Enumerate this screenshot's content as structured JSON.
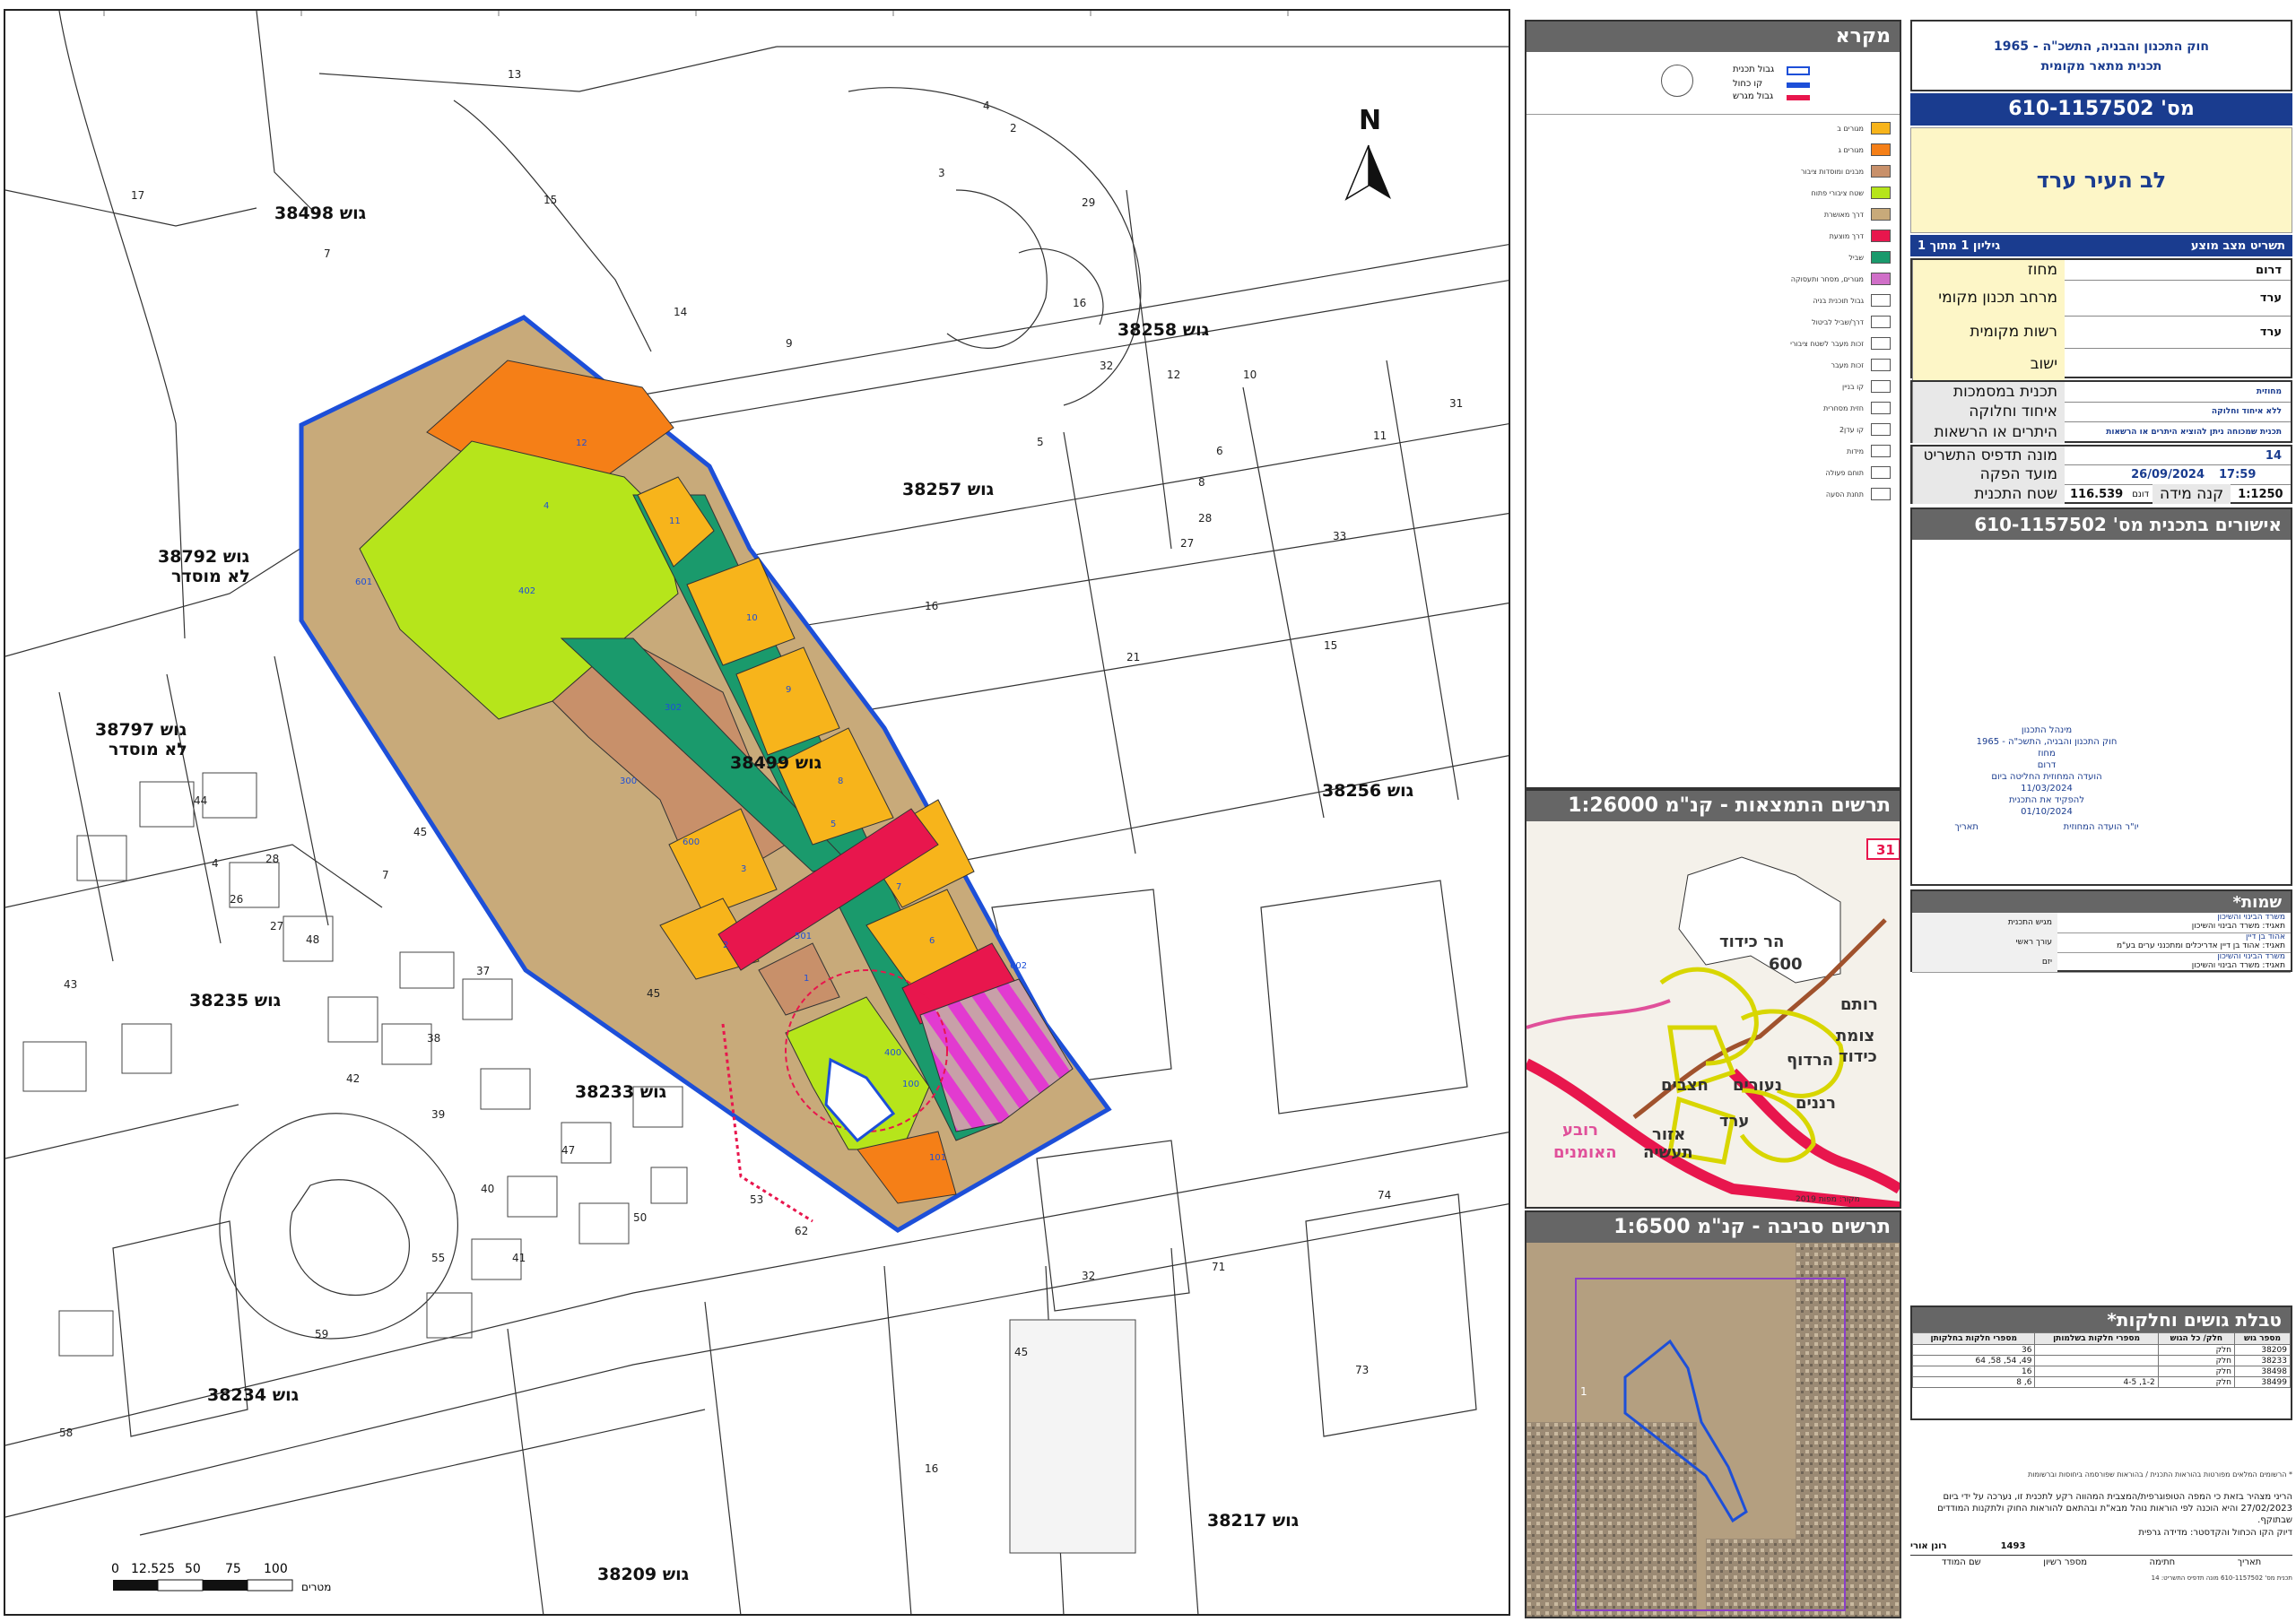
{
  "map": {
    "north_label": "N",
    "blocks": [
      {
        "label": "גוש 38498"
      },
      {
        "label": "גוש 38258"
      },
      {
        "label": "גוש 38257"
      },
      {
        "label": "גוש 38792",
        "sub": "לא מוסדר"
      },
      {
        "label": "גוש 38797",
        "sub": "לא מוסדר"
      },
      {
        "label": "גוש 38499"
      },
      {
        "label": "גוש 38256"
      },
      {
        "label": "גוש 38235"
      },
      {
        "label": "גוש 38233"
      },
      {
        "label": "גוש 38234"
      },
      {
        "label": "גוש 38217"
      },
      {
        "label": "גוש 38209"
      }
    ],
    "parcels": [
      "13",
      "17",
      "7",
      "15",
      "14",
      "3",
      "4",
      "16",
      "29",
      "2",
      "6",
      "5",
      "32",
      "12",
      "10",
      "31",
      "11",
      "9",
      "8",
      "28",
      "27",
      "33",
      "21",
      "15",
      "16",
      "44",
      "45",
      "7",
      "28",
      "26",
      "4",
      "27",
      "43",
      "48",
      "42",
      "37",
      "38",
      "39",
      "40",
      "41",
      "45",
      "47",
      "50",
      "53",
      "62",
      "55",
      "59",
      "58",
      "45",
      "16",
      "71",
      "73",
      "74",
      "32"
    ],
    "zone_numbers": [
      "12",
      "11",
      "10",
      "9",
      "8",
      "7",
      "6",
      "5",
      "4",
      "3",
      "2",
      "1",
      "402",
      "300",
      "302",
      "501",
      "600",
      "601",
      "602",
      "400",
      "101",
      "100"
    ],
    "scale": {
      "ticks": [
        "0",
        "12.525",
        "50",
        "75",
        "100"
      ],
      "unit": "מטרים"
    }
  },
  "legend": {
    "title": "מקרא",
    "items": [
      {
        "label": "מגורים ב",
        "color": "#f7b41b"
      },
      {
        "label": "מגורים ג",
        "color": "#f57f17"
      },
      {
        "label": "מבנים ומוסדות ציבור",
        "color": "#c8906a"
      },
      {
        "label": "שטח ציבורי פתוח",
        "color": "#b6e51b"
      },
      {
        "label": "דרך מאושרת",
        "color": "#c8aa7a"
      },
      {
        "label": "דרך מוצעת",
        "color": "#e8164d"
      },
      {
        "label": "שביל",
        "color": "#1a9a6c"
      },
      {
        "label": "מגורים, מסחר ותעסוקה",
        "color": "#d06fc8"
      },
      {
        "label": "גבול תוכנית בניה",
        "color": "#ffffff"
      },
      {
        "label": "דרך/שביל לביטול",
        "color": "#ffffff"
      },
      {
        "label": "זכות מעבר לשטח ציבורי",
        "color": "#ffffff"
      },
      {
        "label": "זכות מעבר",
        "color": "#ffffff"
      },
      {
        "label": "קו בניין",
        "color": "#ffffff"
      },
      {
        "label": "חזית מסחרית",
        "color": "#ffffff"
      },
      {
        "label": "קו עדן2",
        "color": "#ffffff"
      },
      {
        "label": "מידות",
        "color": "#ffffff"
      },
      {
        "label": "תוחם פעולה",
        "color": "#ffffff"
      },
      {
        "label": "תחנת הסעה",
        "color": "#ffffff"
      }
    ],
    "north_legend": [
      "גבול תכנית",
      "קו כחול",
      "גבול מגרש"
    ]
  },
  "location_map": {
    "title": "תרשים התמצאות - קנ\"מ 1:26000",
    "labels": [
      "הר כידוד",
      "600",
      "רותם",
      "צומת",
      "כידוד",
      "הרדוף",
      "נעורים",
      "ערד",
      "רננים",
      "רובע",
      "האומנים",
      "אזור",
      "תעשיה",
      "חצבים"
    ],
    "road": "31",
    "source": "מקור: מפות 2019"
  },
  "surroundings_map": {
    "title": "תרשים סביבה - קנ\"מ 1:6500",
    "marker": "1"
  },
  "plan": {
    "law_line1": "חוק התכנון והבניה, התשכ\"ה - 1965",
    "law_line2": "תכנית מתאר מקומית",
    "number_label": "מס' 610-1157502",
    "name": "לב העיר ערד",
    "sheet_title": "תשריט מצב מוצע",
    "sheet_info": "גיליון 1 מתוך 1",
    "rows": [
      {
        "label": "מחוז",
        "value": "דרום"
      },
      {
        "label": "מרחב תכנון מקומי",
        "value": "ערד"
      },
      {
        "label": "רשות מקומית",
        "value": "ערד"
      },
      {
        "label": "ישוב",
        "value": ""
      }
    ],
    "rows2": [
      {
        "label": "תכנית במסמכות",
        "value": "מחוזית"
      },
      {
        "label": "איחוד וחלוקה",
        "value": "ללא איחוד וחלוקה"
      },
      {
        "label": "היתרים או הרשאות",
        "value": "תכנית שמכוחה ניתן להוציא היתרים או הרשאות"
      }
    ],
    "print_counter_label": "מונה תדפיס התשריט",
    "print_counter": "14",
    "produced_label": "מועד הפקה",
    "produced_date": "26/09/2024",
    "produced_time": "17:59",
    "area_label": "שטח התכנית",
    "area_value": "116.539",
    "area_unit": "דונם",
    "scale_label": "קנה מידה",
    "scale_value": "1:1250"
  },
  "approvals": {
    "title": "אישורים בתכנית מס' 610-1157502",
    "stamp": [
      "מינהל התכנון",
      "חוק התכנון והבניה, התשכ\"ה - 1965",
      "מחוז",
      "דרום",
      "הועדה המחוזית החליטה ביום",
      "11/03/2024",
      "להפקיד את התכנית",
      "01/10/2024",
      "תאריך",
      "יו\"ר הועדה המחוזית"
    ]
  },
  "names": {
    "title": "שמות*",
    "rows": [
      {
        "role": "מגיש התכנית",
        "name": "משרד הבינוי והשיכון",
        "sub": "תאגיד: משרד הבינוי והשיכון"
      },
      {
        "role": "עורך ראשי",
        "name": "אהוד בן דיין",
        "sub": "תאגיד: אהוד בן דיין אדריכלים ומתכנני ערים בע\"מ"
      },
      {
        "role": "יזם",
        "name": "משרד הבינוי והשיכון",
        "sub": "תאגיד: משרד הבינוי והשיכון"
      }
    ]
  },
  "parcels_table": {
    "title": "טבלת גושים וחלקות*",
    "headers": [
      "מספר גוש",
      "חלק/ כל הגוש",
      "מספרי חלקות בשלמותן",
      "מספרי חלקות בחלקותן"
    ],
    "rows": [
      [
        "38209",
        "חלק",
        "",
        "36"
      ],
      [
        "38233",
        "חלק",
        "",
        "49, 54, 58, 64"
      ],
      [
        "38498",
        "חלק",
        "",
        "16"
      ],
      [
        "38499",
        "חלק",
        "1-2, 4-5",
        "6, 8"
      ]
    ]
  },
  "footer": {
    "note": "* הרשומים המלאים מפורטות בהוראות התכנית / בהוראות שפורסמה ביחוסות וברשומות",
    "decl": "הריני מצהיר בזאת כי המפה הטופוגרפית/המצבית המהווה רקע לתכנית זו, נערכה על ידי ביום 27/02/2023 והיא הוכנה לפי הוראות נוהל מבא\"ת ובהתאם להוראות החוק ולתקנות המודדים שבתוקף.",
    "decl2": "דיוק הקו הכחול והקדסטר: מדידה גרפית",
    "surveyor_name": "רונן אורי",
    "license": "1493",
    "cols": [
      "שם המודד",
      "מספר רשיון",
      "חתימה",
      "תאריך"
    ],
    "bottom": "תכנית מס' 610-1157502 מונה תדפיס התשריט: 14"
  }
}
